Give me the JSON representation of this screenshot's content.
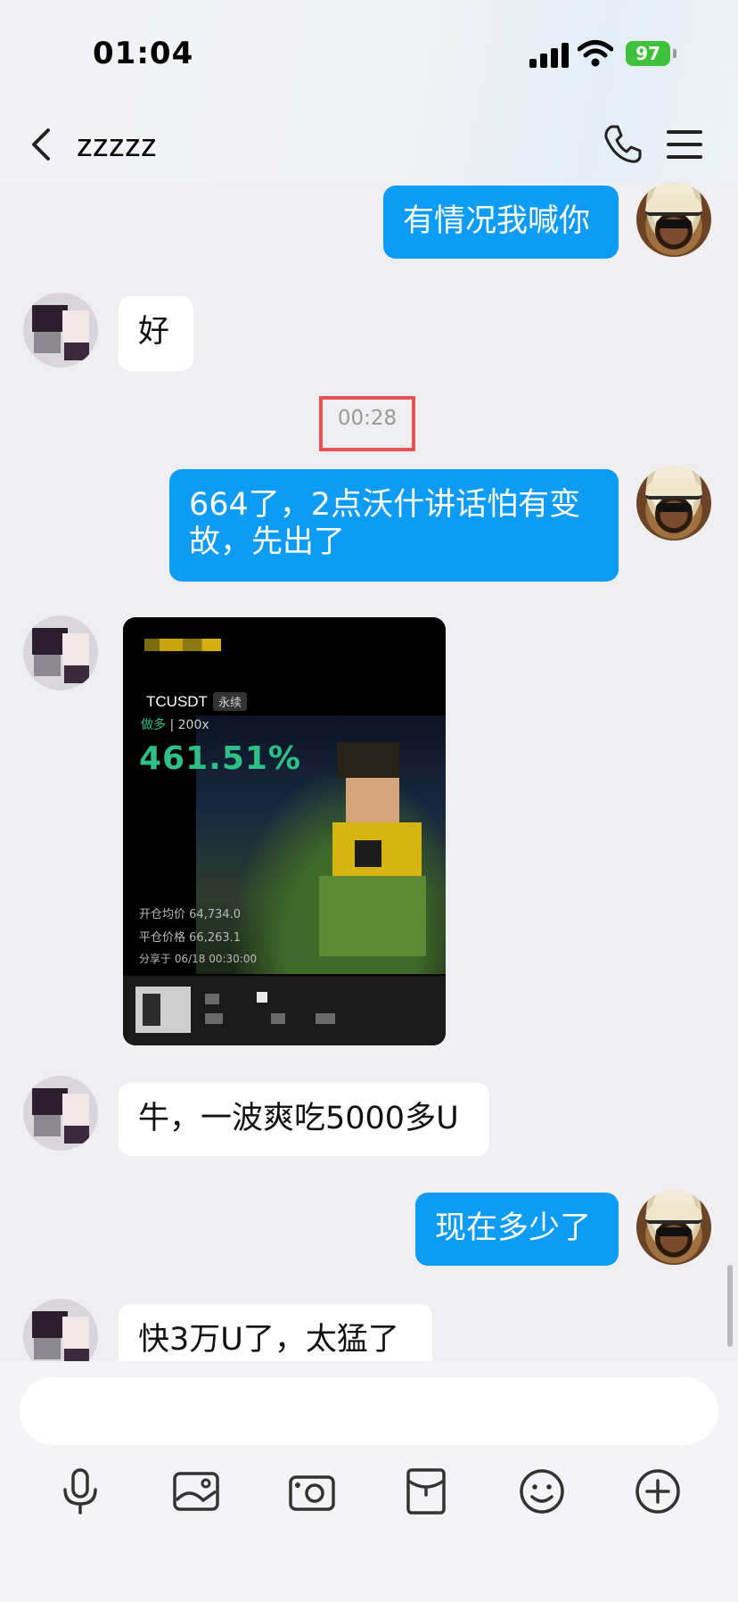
{
  "status_bar": {
    "time": "01:04",
    "battery_level": "97",
    "battery_color": "#3ec23c"
  },
  "header": {
    "title": "zzzzz"
  },
  "messages": [
    {
      "side": "self",
      "type": "text",
      "text": "有情况我喊你"
    },
    {
      "side": "other",
      "type": "text",
      "text": "好"
    },
    {
      "type": "timestamp",
      "text": "00:28"
    },
    {
      "side": "self",
      "type": "text",
      "text": "664了，2点沃什讲话怕有变\n故，先出了"
    },
    {
      "side": "other",
      "type": "image",
      "card": {
        "symbol": "TCUSDT",
        "tag": "永续",
        "side_text": "做多",
        "leverage": "200x",
        "pnl": "461.51%",
        "open_label": "开仓均价",
        "open_value": "64,734.0",
        "close_label": "平仓价格",
        "close_value": "66,263.1",
        "share_text": "分享于 06/18 00:30:00"
      }
    },
    {
      "side": "other",
      "type": "text",
      "text": "牛，一波爽吃5000多U"
    },
    {
      "side": "self",
      "type": "text",
      "text": "现在多少了"
    },
    {
      "side": "other",
      "type": "text",
      "text": "快3万U了，太猛了"
    }
  ],
  "composer": {
    "input_value": "",
    "tools": [
      "microphone-icon",
      "image-icon",
      "camera-icon",
      "red-packet-icon",
      "emoji-icon",
      "plus-icon"
    ]
  },
  "colors": {
    "self_bubble": "#0c9bf5",
    "other_bubble": "#ffffff",
    "timestamp_highlight": "#e45252",
    "pnl_green": "#2fbf86"
  }
}
